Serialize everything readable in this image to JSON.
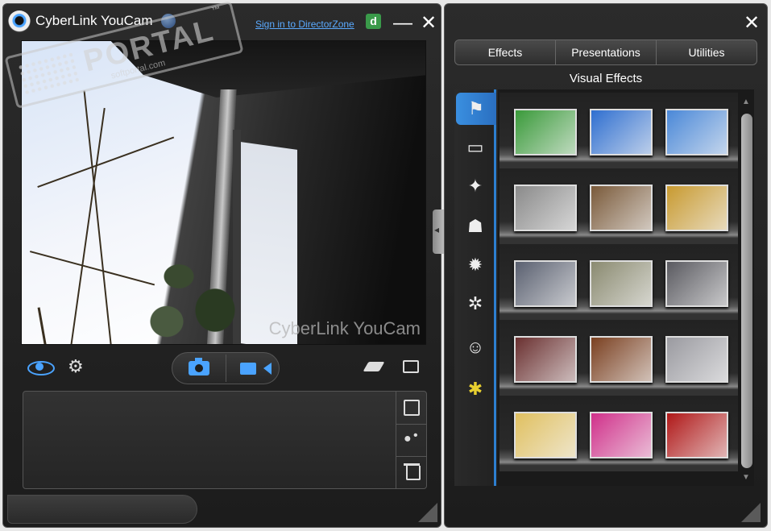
{
  "window": {
    "title": "CyberLink YouCam",
    "signin_link": "Sign in to DirectorZone",
    "minimize": "—",
    "close": "✕"
  },
  "watermark": {
    "text": "PORTAL",
    "tm": "™",
    "url": "softportal.com"
  },
  "webcam": {
    "overlay_text": "CyberLink YouCam"
  },
  "right_panel": {
    "close": "✕",
    "tabs": [
      "Effects",
      "Presentations",
      "Utilities"
    ],
    "section_title": "Visual Effects",
    "categories": [
      {
        "icon": "scene-icon"
      },
      {
        "icon": "frame-icon"
      },
      {
        "icon": "particle-icon"
      },
      {
        "icon": "mask-icon"
      },
      {
        "icon": "avatar-icon"
      },
      {
        "icon": "distortion-icon"
      },
      {
        "icon": "emotion-icon"
      },
      {
        "icon": "gadget-icon"
      }
    ],
    "thumbnail_colors": [
      [
        "#3a9a3a",
        "#2f6fd0",
        "#4a88d8"
      ],
      [
        "#8a8a8a",
        "#7a5a3a",
        "#c89a30"
      ],
      [
        "#5a6070",
        "#8a8a70",
        "#5a5a60"
      ],
      [
        "#6a3030",
        "#7a4020",
        "#9a9aa0"
      ],
      [
        "#e0c060",
        "#d0308a",
        "#b01818"
      ]
    ]
  },
  "colors": {
    "accent": "#4aa3ff",
    "panel_bg": "#222222"
  }
}
